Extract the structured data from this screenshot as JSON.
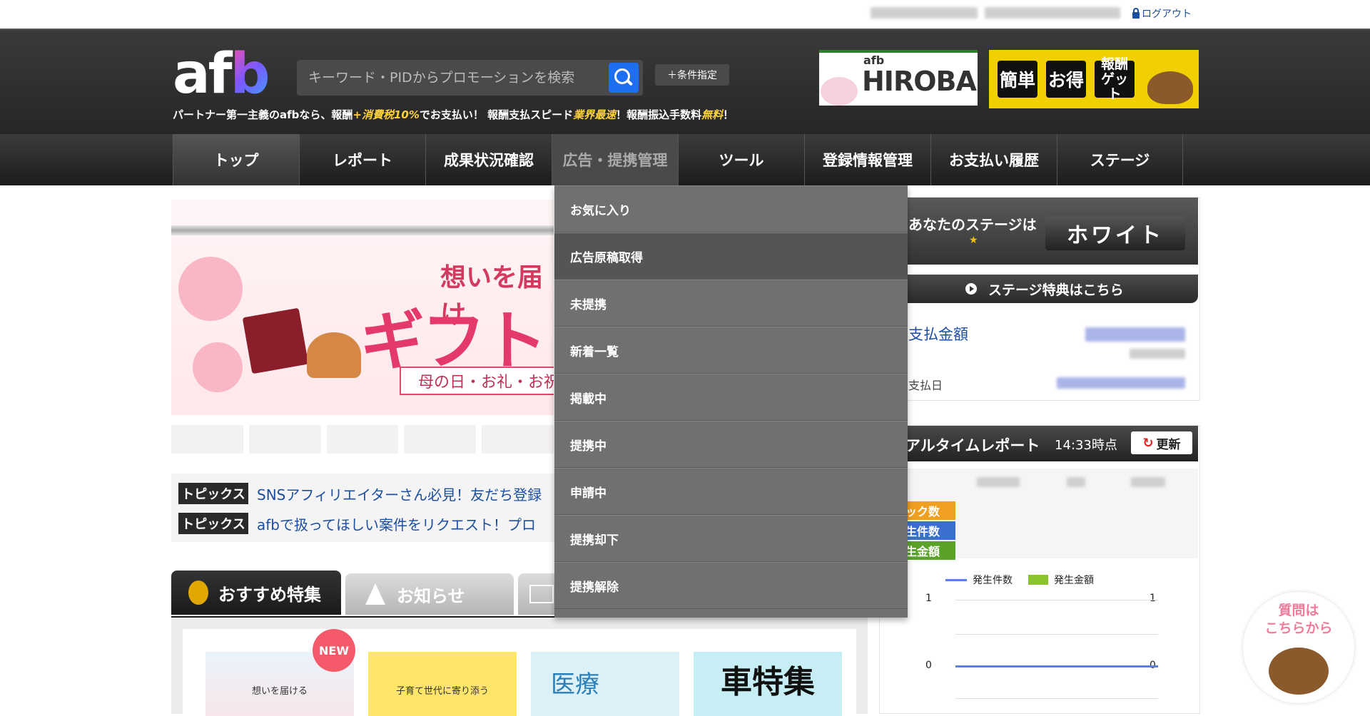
{
  "topbar": {
    "logout": "ログアウト"
  },
  "header": {
    "logo_prefix": "af",
    "logo_b": "b",
    "tagline_1": "パートナー第一主義のafbなら、報酬",
    "tagline_2": "+消費税10%",
    "tagline_3": "でお支払い！ 報酬支払スピード",
    "tagline_4": "業界最速",
    "tagline_5": "！報酬振込手数料",
    "tagline_6": "無料",
    "tagline_7": "！",
    "search_placeholder": "キーワード・PIDからプロモーションを検索",
    "condition_button": "＋条件指定",
    "hiroba_small": "afb",
    "hiroba_big": "HIROBA",
    "promo_1": "簡単",
    "promo_2": "お得",
    "promo_3": "報酬ゲット"
  },
  "nav": [
    "トップ",
    "レポート",
    "成果状況確認",
    "広告・提携管理",
    "ツール",
    "登録情報管理",
    "お支払い履歴",
    "ステージ"
  ],
  "dropdown": [
    "お気に入り",
    "広告原稿取得",
    "未提携",
    "新着一覧",
    "掲載中",
    "提携中",
    "申請中",
    "提携却下",
    "提携解除"
  ],
  "banner": {
    "title_1": "想いを届け",
    "title_2": "ギフト",
    "subtitle": "母の日・お礼・お祝"
  },
  "topics": {
    "tag": "トピックス",
    "items": [
      "SNSアフィリエイターさん必見！友だち登録",
      "afbで扱ってほしい案件をリクエスト！プロ"
    ]
  },
  "tabs": [
    "おすすめ特集",
    "お知らせ"
  ],
  "featured": {
    "new_badge": "NEW",
    "card1": "想いを届ける",
    "card2": "子育て世代に寄り添う",
    "card3": "医療",
    "card4": "車特集"
  },
  "stage": {
    "label": "あなたのステージは",
    "value": "ホワイト",
    "benefit": "ステージ特典はこちら",
    "pay_amount_label": "支払金額",
    "pay_date_label": "支払日"
  },
  "realtime": {
    "title": "アルタイムレポート",
    "time": "14:33時点",
    "refresh": "更新",
    "rows": [
      "ック数",
      "生件数",
      "生金額"
    ],
    "legend_1": "発生件数",
    "legend_2": "発生金額",
    "axis_top": "1",
    "axis_zero": "0"
  },
  "help": {
    "line1": "質問は",
    "line2": "こちらから"
  }
}
